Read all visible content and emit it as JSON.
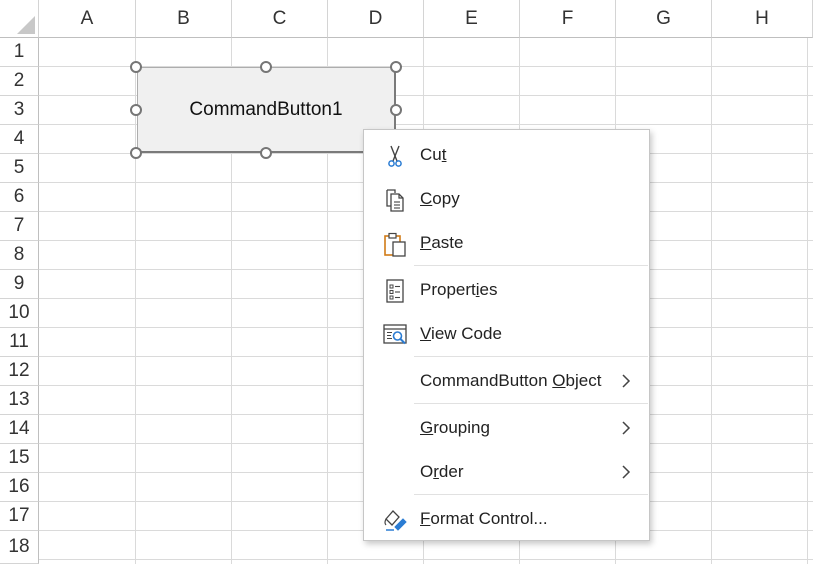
{
  "spreadsheet": {
    "columns": [
      "A",
      "B",
      "C",
      "D",
      "E",
      "F",
      "G",
      "H"
    ],
    "rows": [
      "1",
      "2",
      "3",
      "4",
      "5",
      "6",
      "7",
      "8",
      "9",
      "10",
      "11",
      "12",
      "13",
      "14",
      "15",
      "16",
      "17",
      "18"
    ]
  },
  "command_button": {
    "caption": "CommandButton1"
  },
  "context_menu": {
    "cut": {
      "pre": "Cu",
      "key": "t",
      "post": "",
      "icon": "scissors-icon"
    },
    "copy": {
      "pre": "",
      "key": "C",
      "post": "opy",
      "icon": "copy-icon"
    },
    "paste": {
      "pre": "",
      "key": "P",
      "post": "aste",
      "icon": "paste-icon"
    },
    "properties": {
      "pre": "Propert",
      "key": "i",
      "post": "es",
      "icon": "properties-icon"
    },
    "view_code": {
      "pre": "",
      "key": "V",
      "post": "iew Code",
      "icon": "view-code-icon"
    },
    "object": {
      "pre": "CommandButton ",
      "key": "O",
      "post": "bject"
    },
    "grouping": {
      "pre": "",
      "key": "G",
      "post": "rouping"
    },
    "order": {
      "pre": "O",
      "key": "r",
      "post": "der"
    },
    "format_control": {
      "pre": "",
      "key": "F",
      "post": "ormat Control...",
      "icon": "format-control-icon"
    }
  }
}
